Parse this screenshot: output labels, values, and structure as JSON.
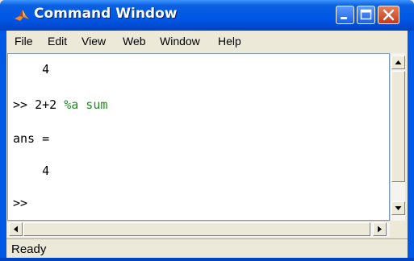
{
  "window": {
    "title": "Command Window",
    "icon": "matlab-logo-icon",
    "controls": [
      "minimize-icon",
      "maximize-icon",
      "close-icon"
    ]
  },
  "menu": {
    "items": [
      {
        "label": "File"
      },
      {
        "label": "Edit"
      },
      {
        "label": "View"
      },
      {
        "label": "Web"
      },
      {
        "label": "Window"
      },
      {
        "label": "Help"
      }
    ]
  },
  "console": {
    "line1": "    4",
    "prompt1": ">> ",
    "command": "2+2 ",
    "comment": "%a sum",
    "ans_label": "ans =",
    "ans_value": "    4",
    "prompt2": ">>"
  },
  "status": {
    "text": "Ready"
  },
  "colors": {
    "titlebar": "#0058e6",
    "comment": "#228b22",
    "chrome": "#ece9d8"
  }
}
